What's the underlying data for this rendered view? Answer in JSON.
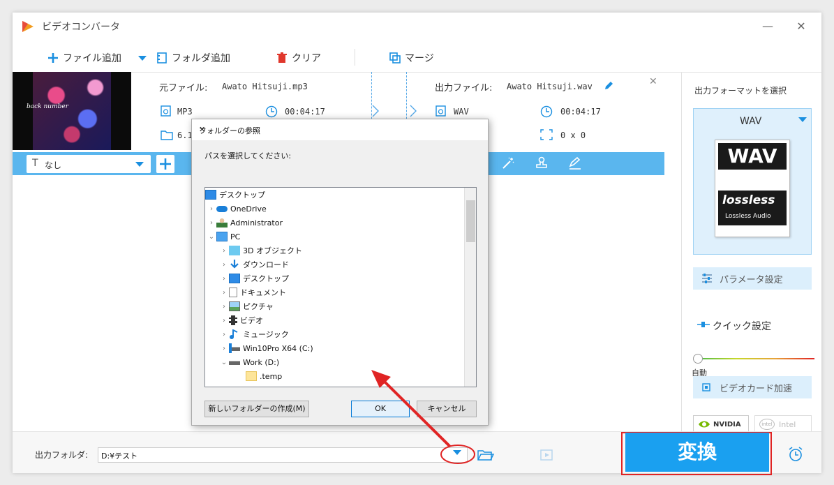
{
  "app": {
    "title": "ビデオコンバータ"
  },
  "toolbar": {
    "add_file": "ファイル追加",
    "add_folder": "フォルダ追加",
    "clear": "クリア",
    "merge": "マージ"
  },
  "file": {
    "source_label": "元ファイル:",
    "source_name": "Awato Hitsuji.mp3",
    "output_label": "出力ファイル:",
    "output_name": "Awato Hitsuji.wav",
    "source_format": "MP3",
    "source_duration": "00:04:17",
    "source_size": "6.1",
    "output_format": "WAV",
    "output_duration": "00:04:17",
    "output_resolution": "0 x 0",
    "thumb_caption": "back number"
  },
  "options": {
    "subtitle_value": "なし"
  },
  "sidebar": {
    "format_heading": "出力フォーマットを選択",
    "format_value": "WAV",
    "wav_badge": "WAV",
    "lossless_logo": "lossless",
    "lossless_sub": "Lossless Audio",
    "param_settings": "パラメータ設定",
    "quick_settings": "クイック設定",
    "slider_label": "自動",
    "gpu_accel": "ビデオカード加速",
    "nvidia": "NVIDIA",
    "intel": "Intel"
  },
  "bottom": {
    "output_folder_label": "出力フォルダ:",
    "output_path": "D:¥テスト",
    "convert_label": "変換"
  },
  "dialog": {
    "title": "フォルダーの参照",
    "prompt": "パスを選択してください:",
    "new_folder": "新しいフォルダーの作成(M)",
    "ok": "OK",
    "cancel": "キャンセル",
    "tree": [
      {
        "label": "デスクトップ",
        "icon": "desktop-icon"
      },
      {
        "label": "OneDrive",
        "icon": "cloud-icon"
      },
      {
        "label": "Administrator",
        "icon": "user-icon"
      },
      {
        "label": "PC",
        "icon": "pc-icon"
      },
      {
        "label": "3D オブジェクト",
        "icon": "cube-icon"
      },
      {
        "label": "ダウンロード",
        "icon": "download-icon"
      },
      {
        "label": "デスクトップ",
        "icon": "desktop-icon"
      },
      {
        "label": "ドキュメント",
        "icon": "document-icon"
      },
      {
        "label": "ピクチャ",
        "icon": "picture-icon"
      },
      {
        "label": "ビデオ",
        "icon": "video-icon"
      },
      {
        "label": "ミュージック",
        "icon": "music-icon"
      },
      {
        "label": "Win10Pro X64 (C:)",
        "icon": "drive-icon"
      },
      {
        "label": "Work (D:)",
        "icon": "drive-icon"
      },
      {
        "label": ".temp",
        "icon": "folder-icon"
      }
    ]
  },
  "colors": {
    "accent": "#1aa0f0",
    "highlight": "#e02424",
    "option_bar": "#5ab6ee"
  }
}
